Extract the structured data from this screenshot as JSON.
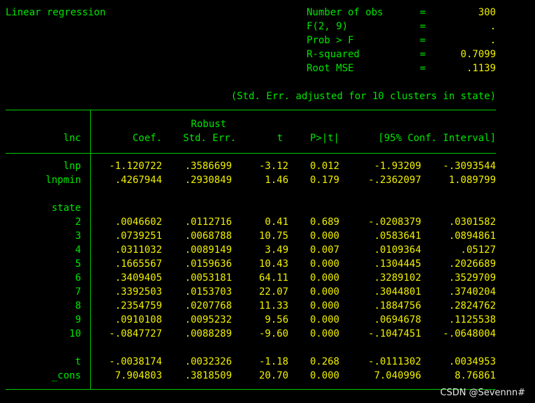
{
  "title": "Linear regression",
  "stats": [
    {
      "label": "Number of obs",
      "eq": "=",
      "value": "300"
    },
    {
      "label": "F(2, 9)",
      "eq": "=",
      "value": "."
    },
    {
      "label": "Prob > F",
      "eq": "=",
      "value": "."
    },
    {
      "label": "R-squared",
      "eq": "=",
      "value": "0.7099"
    },
    {
      "label": "Root MSE",
      "eq": "=",
      "value": ".1139"
    }
  ],
  "note": "(Std. Err. adjusted for 10 clusters in state)",
  "header": {
    "depvar": "lnc",
    "coef": "Coef.",
    "robust": "Robust",
    "se": "Std. Err.",
    "t": "t",
    "p": "P>|t|",
    "ci": "[95% Conf. Interval]"
  },
  "rows": [
    {
      "name": "lnp",
      "coef": "-1.120722",
      "se": ".3586699",
      "t": "-3.12",
      "p": "0.012",
      "lo": "-1.93209",
      "hi": "-.3093544"
    },
    {
      "name": "lnpmin",
      "coef": ".4267944",
      "se": ".2930849",
      "t": "1.46",
      "p": "0.179",
      "lo": "-.2362097",
      "hi": "1.089799"
    },
    {
      "name": "state",
      "heading": true
    },
    {
      "name": "2",
      "coef": ".0046602",
      "se": ".0112716",
      "t": "0.41",
      "p": "0.689",
      "lo": "-.0208379",
      "hi": ".0301582"
    },
    {
      "name": "3",
      "coef": ".0739251",
      "se": ".0068788",
      "t": "10.75",
      "p": "0.000",
      "lo": ".0583641",
      "hi": ".0894861"
    },
    {
      "name": "4",
      "coef": ".0311032",
      "se": ".0089149",
      "t": "3.49",
      "p": "0.007",
      "lo": ".0109364",
      "hi": ".05127"
    },
    {
      "name": "5",
      "coef": ".1665567",
      "se": ".0159636",
      "t": "10.43",
      "p": "0.000",
      "lo": ".1304445",
      "hi": ".2026689"
    },
    {
      "name": "6",
      "coef": ".3409405",
      "se": ".0053181",
      "t": "64.11",
      "p": "0.000",
      "lo": ".3289102",
      "hi": ".3529709"
    },
    {
      "name": "7",
      "coef": ".3392503",
      "se": ".0153703",
      "t": "22.07",
      "p": "0.000",
      "lo": ".3044801",
      "hi": ".3740204"
    },
    {
      "name": "8",
      "coef": ".2354759",
      "se": ".0207768",
      "t": "11.33",
      "p": "0.000",
      "lo": ".1884756",
      "hi": ".2824762"
    },
    {
      "name": "9",
      "coef": ".0910108",
      "se": ".0095232",
      "t": "9.56",
      "p": "0.000",
      "lo": ".0694678",
      "hi": ".1125538"
    },
    {
      "name": "10",
      "coef": "-.0847727",
      "se": ".0088289",
      "t": "-9.60",
      "p": "0.000",
      "lo": "-.1047451",
      "hi": "-.0648004"
    },
    {
      "name": "t",
      "coef": "-.0038174",
      "se": ".0032326",
      "t": "-1.18",
      "p": "0.268",
      "lo": "-.0111302",
      "hi": ".0034953"
    },
    {
      "name": "_cons",
      "coef": "7.904803",
      "se": ".3818509",
      "t": "20.70",
      "p": "0.000",
      "lo": "7.040996",
      "hi": "8.76861"
    }
  ],
  "watermark": "CSDN @Sevennn#"
}
